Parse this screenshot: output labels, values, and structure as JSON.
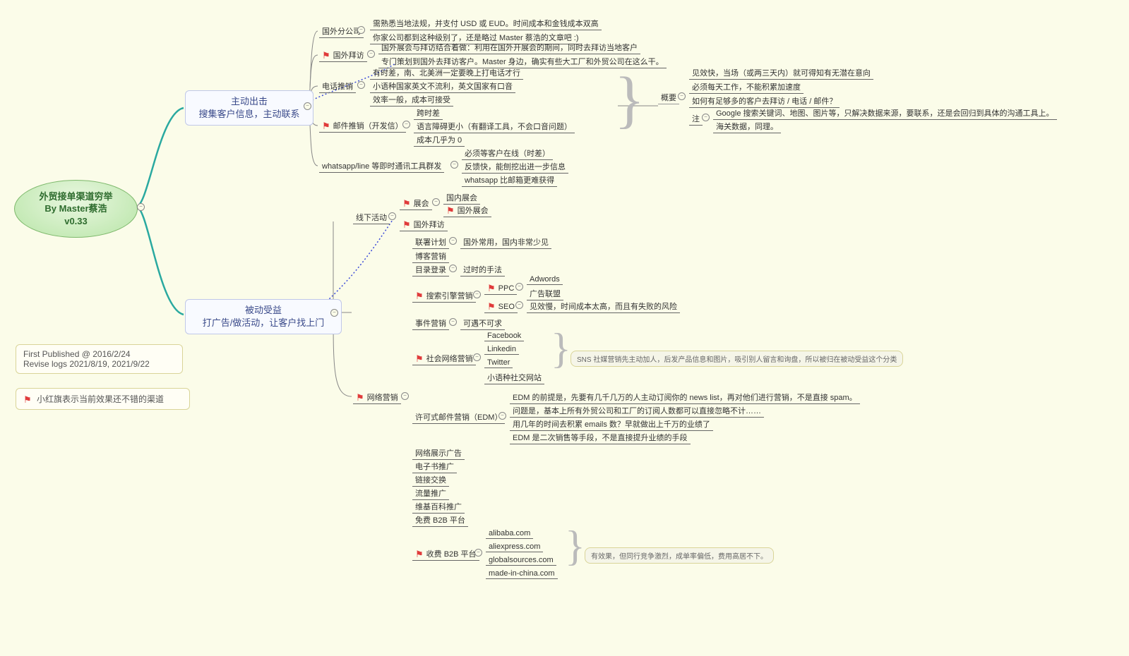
{
  "root": {
    "line1": "外贸接单渠道穷举",
    "line2": "By Master蔡浩",
    "line3": "v0.33"
  },
  "legend1": {
    "line1": "First Published @ 2016/2/24",
    "line2": "Revise logs 2021/8/19, 2021/9/22"
  },
  "legend2": "小红旗表示当前效果还不错的渠道",
  "branchA": {
    "line1": "主动出击",
    "line2": "搜集客户信息，主动联系"
  },
  "branchB": {
    "line1": "被动受益",
    "line2": "打广告/做活动，让客户找上门"
  },
  "a1": "国外分公司",
  "a1a": "需熟悉当地法规，并支付 USD 或 EUD。时间成本和金钱成本双高",
  "a1b": "你家公司都到这种级别了，还是略过 Master 蔡浩的文章吧 :)",
  "a2": "国外拜访",
  "a2a": "国外展会与拜访结合着做：利用在国外开展会的期间，同时去拜访当地客户",
  "a2b": "专门策划到国外去拜访客户。Master 身边，确实有些大工厂和外贸公司在这么干。",
  "a3": "电话推销",
  "a3a": "有时差，南、北美洲一定要晚上打电话才行",
  "a3b": "小语种国家英文不流利，英文国家有口音",
  "a3c": "效率一般，成本可接受",
  "a4": "邮件推销（开发信）",
  "a4a": "跨时差",
  "a4b": "语言障碍更小（有翻译工具，不会口音问题）",
  "a4c": "成本几乎为 0",
  "a5": "whatsapp/line 等即时通讯工具群发",
  "a5a": "必须等客户在线（时差）",
  "a5b": "反馈快，能刨挖出进一步信息",
  "a5c": "whatsapp 比邮箱更难获得",
  "sum": "概要",
  "sum1": "见效快，当场（或两三天内）就可得知有无潜在意向",
  "sum2": "必须每天工作，不能积累加速度",
  "sum3": "如何有足够多的客户去拜访 / 电话 / 邮件？",
  "sum4": "注",
  "sum4a": "Google 搜索关键词、地图、图片等，只解决数据来源，要联系，还是会回归到具体的沟通工具上。",
  "sum4b": "海关数据，同理。",
  "offline": "线下活动",
  "off1": "展会",
  "off1a": "国内展会",
  "off1b": "国外展会",
  "off2": "国外拜访",
  "net": "网络营销",
  "n1": "联署计划",
  "n1a": "国外常用，国内非常少见",
  "n2": "博客营销",
  "n3": "目录登录",
  "n3a": "过时的手法",
  "n4": "搜索引擎营销",
  "n4p": "PPC",
  "n4p1": "Adwords",
  "n4p2": "广告联盟",
  "n4s": "SEO",
  "n4s1": "见效慢，时间成本太高，而且有失败的风险",
  "n5": "事件营销",
  "n5a": "可遇不可求",
  "n6": "社会网络营销",
  "n6a": "Facebook",
  "n6b": "Linkedin",
  "n6c": "Twitter",
  "n6d": "小语种社交网站",
  "n6note": "SNS 社媒营销先主动加人，后发产品信息和图片，吸引别人留言和询盘，所以被归在被动受益这个分类",
  "n7": "许可式邮件营销（EDM）",
  "n7a": "EDM 的前提是，先要有几千几万的人主动订阅你的 news list，再对他们进行营销，不是直接 spam。",
  "n7b": "问题是，基本上所有外贸公司和工厂的订阅人数都可以直接忽略不计……",
  "n7c": "用几年的时间去积累 emails 数？早就做出上千万的业绩了",
  "n7d": "EDM 是二次销售等手段，不是直接提升业绩的手段",
  "n8": "网络展示广告",
  "n9": "电子书推广",
  "n10": "链接交换",
  "n11": "流量推广",
  "n12": "维基百科推广",
  "n13": "免费 B2B 平台",
  "n14": "收费 B2B 平台",
  "n14a": "alibaba.com",
  "n14b": "aliexpress.com",
  "n14c": "globalsources.com",
  "n14d": "made-in-china.com",
  "n14note": "有效果，但同行竞争激烈，成单率偏低，费用高居不下。"
}
